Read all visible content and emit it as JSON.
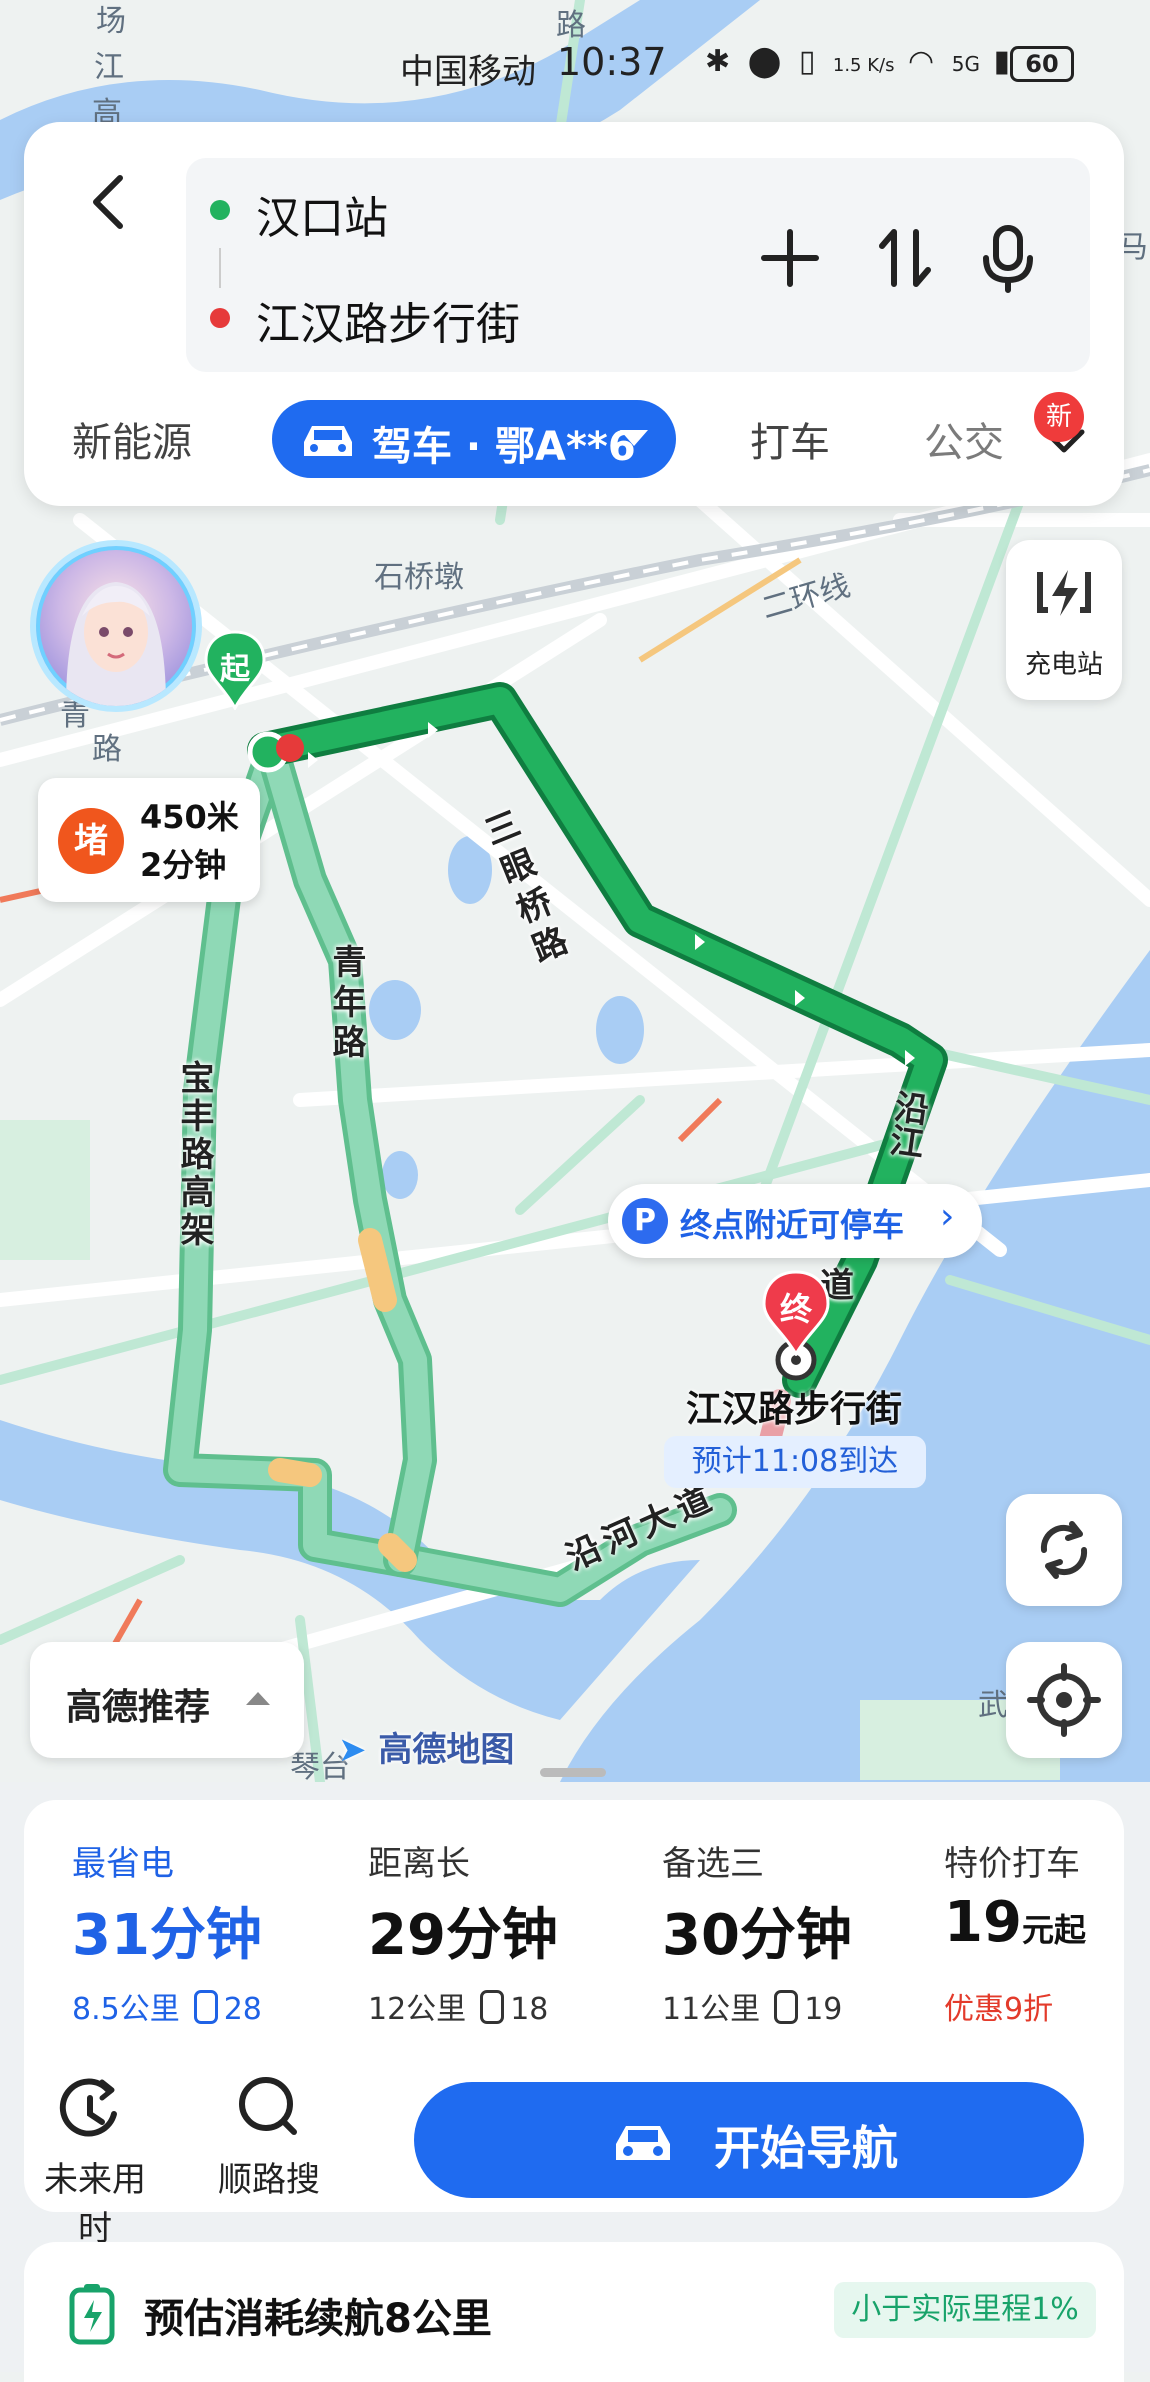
{
  "status_bar": {
    "carrier": "中国移动",
    "time": "10:37",
    "net_speed": "1.5 K/s",
    "network": "5G",
    "battery": "60"
  },
  "route_input": {
    "origin": "汉口站",
    "destination": "江汉路步行街"
  },
  "mode_tabs": {
    "new_energy": "新能源",
    "drive": "驾车 · 鄂A**6",
    "taxi": "打车",
    "transit": "公交",
    "new_badge": "新"
  },
  "map": {
    "labels": {
      "area1": "石桥墩",
      "ring": "二环线",
      "road_sanyan": "三眼桥路",
      "road_qingnian": "青年路",
      "road_baofeng": "宝丰路高架",
      "road_yanhe": "沿河大道",
      "road_yanjiang_top": "沿江",
      "road_yanjiang_bottom": "道",
      "edge_qing": "青",
      "edge_lu": "路",
      "edge_wu": "武",
      "edge_chang": "场",
      "edge_jiang": "江",
      "edge_gao": "高",
      "edge_lu2": "路",
      "edge_ma": "马",
      "qintai": "琴台"
    },
    "start_marker": "起",
    "end_marker": "终",
    "jam": {
      "badge": "堵",
      "distance": "450米",
      "duration": "2分钟"
    },
    "parking": {
      "icon": "P",
      "text": "终点附近可停车",
      "arrow": "›"
    },
    "destination_label": "江汉路步行街",
    "eta": "预计11:08到达",
    "charging_station": "充电站",
    "recommend": "高德推荐",
    "watermark": "高德地图",
    "route_colors": {
      "main": "#1fa85a",
      "alt": "#8fd9b6",
      "slow": "#f5c77e"
    }
  },
  "routes": [
    {
      "name": "最省电",
      "time": "31分钟",
      "distance": "8.5公里",
      "lights": "28",
      "selected": true
    },
    {
      "name": "距离长",
      "time": "29分钟",
      "distance": "12公里",
      "lights": "18",
      "selected": false
    },
    {
      "name": "备选三",
      "time": "30分钟",
      "distance": "11公里",
      "lights": "19",
      "selected": false
    }
  ],
  "taxi_offer": {
    "name": "特价打车",
    "price": "19",
    "unit": "元起",
    "promo": "优惠9折"
  },
  "actions": {
    "future_time": "未来用时",
    "along_search": "顺路搜",
    "start_navigation": "开始导航"
  },
  "energy": {
    "text": "预估消耗续航8公里",
    "badge": "小于实际里程1%"
  },
  "colors": {
    "accent": "#1f6bf0",
    "promo": "#e33b2b",
    "eco": "#18a36a"
  }
}
